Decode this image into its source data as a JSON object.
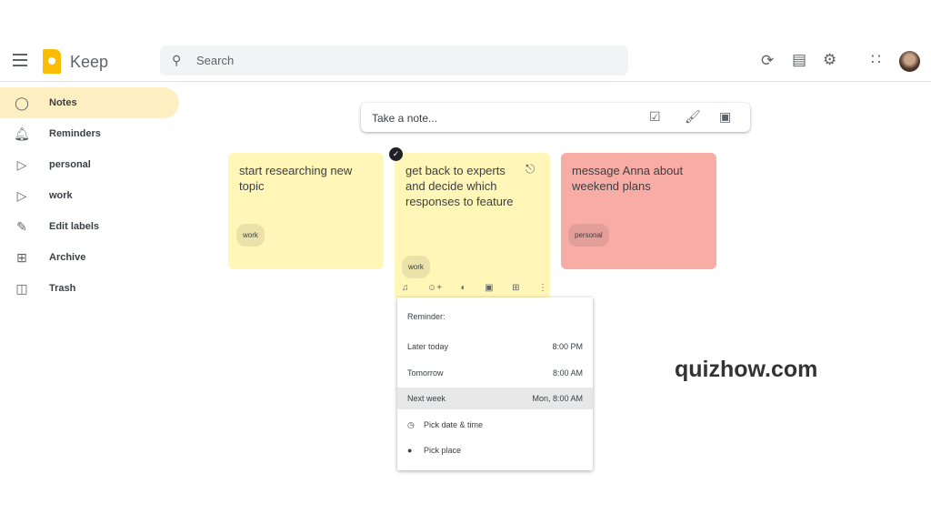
{
  "header": {
    "brand": "Keep",
    "search_placeholder": "Search",
    "icons": [
      "refresh-icon",
      "list-view-icon",
      "settings-icon",
      "apps-icon"
    ]
  },
  "sidebar": {
    "items": [
      {
        "label": "Notes",
        "icon": "lightbulb-icon",
        "active": true
      },
      {
        "label": "Reminders",
        "icon": "bell-icon"
      },
      {
        "label": "personal",
        "icon": "label-icon"
      },
      {
        "label": "work",
        "icon": "label-icon"
      },
      {
        "label": "Edit labels",
        "icon": "pencil-icon"
      },
      {
        "label": "Archive",
        "icon": "archive-icon"
      },
      {
        "label": "Trash",
        "icon": "trash-icon"
      }
    ]
  },
  "take_note": {
    "placeholder": "Take a note..."
  },
  "notes": [
    {
      "text": "start researching new topic",
      "label": "work",
      "color": "#fff6b8"
    },
    {
      "text": "get back to experts and decide which responses to feature",
      "label": "work",
      "color": "#fff6b8",
      "selected": true
    },
    {
      "text": "message Anna about weekend plans",
      "label": "personal",
      "color": "#f8aca6"
    }
  ],
  "reminder_menu": {
    "title": "Reminder:",
    "options": [
      {
        "label": "Later today",
        "time": "8:00 PM"
      },
      {
        "label": "Tomorrow",
        "time": "8:00 AM"
      },
      {
        "label": "Next week",
        "time": "Mon, 8:00 AM",
        "highlighted": true
      }
    ],
    "pick_date": "Pick date & time",
    "pick_place": "Pick place"
  },
  "watermark": "quizhow.com"
}
